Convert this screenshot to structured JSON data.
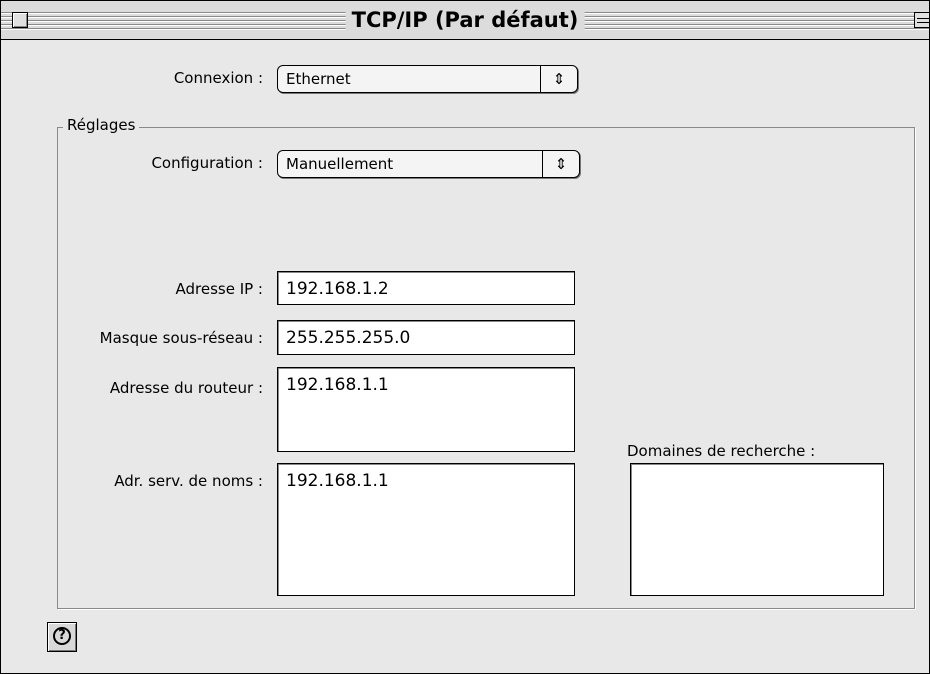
{
  "window": {
    "title": "TCP/IP (Par défaut)"
  },
  "connexion": {
    "label": "Connexion :",
    "value": "Ethernet",
    "arrow": "⇕"
  },
  "reglages": {
    "group_label": "Réglages",
    "configuration": {
      "label": "Configuration :",
      "value": "Manuellement",
      "arrow": "⇕"
    },
    "ip_address": {
      "label": "Adresse IP :",
      "value": "192.168.1.2"
    },
    "subnet_mask": {
      "label": "Masque sous-réseau :",
      "value": "255.255.255.0"
    },
    "router_address": {
      "label": "Adresse du routeur :",
      "value": "192.168.1.1"
    },
    "name_servers": {
      "label": "Adr. serv. de noms :",
      "value": "192.168.1.1"
    },
    "search_domains": {
      "label": "Domaines de recherche :",
      "value": ""
    }
  },
  "help": {
    "glyph": "?",
    "icon": "question-mark-icon"
  },
  "colors": {
    "window_background": "#e8e8e8",
    "titlebar_background": "#dcdcdc",
    "field_background": "#ffffff"
  }
}
